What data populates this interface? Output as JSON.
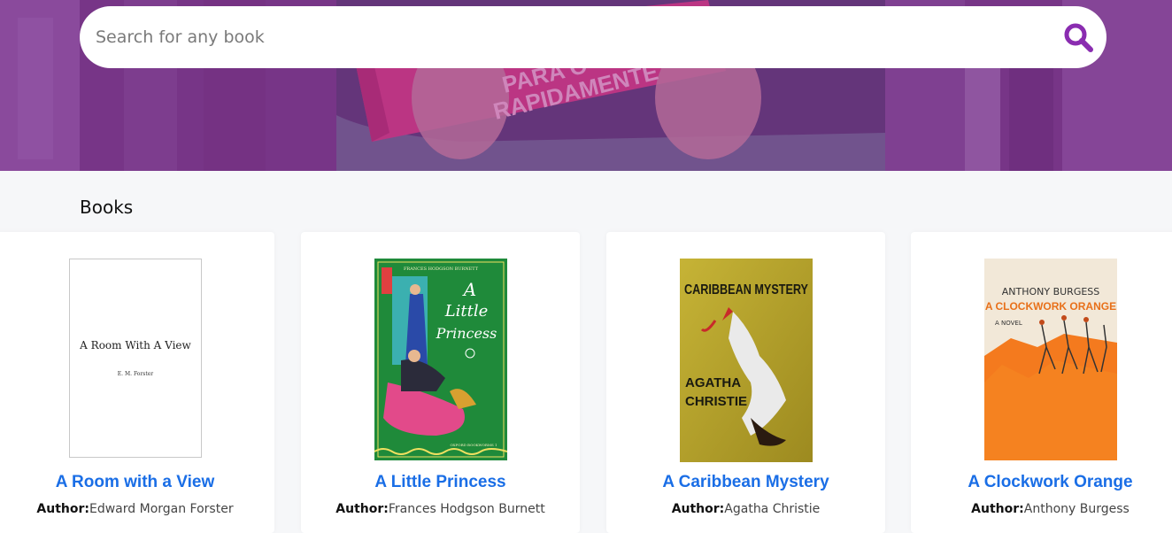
{
  "search": {
    "placeholder": "Search for any book",
    "value": ""
  },
  "section": {
    "title": "Books"
  },
  "author_label": "Author:",
  "books": [
    {
      "title": "A Room with a View",
      "author": "Edward Morgan Forster",
      "cover": {
        "title": "A Room With A View",
        "author": "E. M. Forster"
      }
    },
    {
      "title": "A Little Princess",
      "author": "Frances Hodgson Burnett",
      "cover": {
        "top": "FRANCES HODGSON BURNETT",
        "line1": "A",
        "line2": "Little",
        "line3": "Princess",
        "bottom": "OXFORD BOOKWORMS 1"
      }
    },
    {
      "title": "A Caribbean Mystery",
      "author": "Agatha Christie",
      "cover": {
        "title": "CARIBBEAN MYSTERY",
        "author1": "AGATHA",
        "author2": "CHRISTIE"
      }
    },
    {
      "title": "A Clockwork Orange",
      "author": "Anthony Burgess",
      "cover": {
        "author": "ANTHONY BURGESS",
        "title": "A CLOCKWORK ORANGE",
        "sub": "A NOVEL"
      }
    }
  ],
  "hero_book_text": {
    "line1": "PARA C",
    "line2": "RAPIDAMENTE"
  },
  "colors": {
    "accent": "#8a2cb0",
    "link": "#1a6ee6",
    "hero_overlay": "#7a3a89"
  }
}
